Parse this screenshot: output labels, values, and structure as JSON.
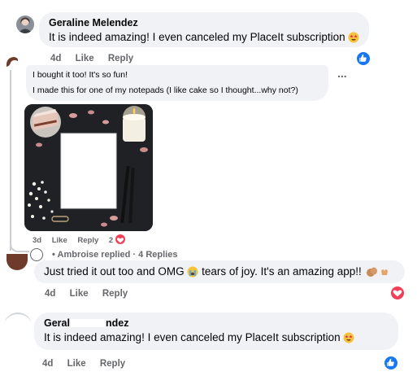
{
  "comment1": {
    "author": "Geraline Melendez",
    "text": "It is indeed amazing! I even canceled my PlaceIt subscription",
    "emoji": "star-struck-emoji",
    "time": "4d",
    "like": "Like",
    "reply": "Reply",
    "reaction": "like-reaction-icon"
  },
  "comment2": {
    "line1": "I bought it too! It's so fun!",
    "line2": "I made this for one of my notepads (I like cake so I thought...why not?)",
    "more": "...",
    "time": "3d",
    "like": "Like",
    "reply": "Reply",
    "reaction_count": "2",
    "reaction": "love-reaction-icon"
  },
  "replies_summary": {
    "author_fragment": "Ambroise replied",
    "separator": "·",
    "count": "4 Replies"
  },
  "comment3": {
    "text": "Just tried it out too and OMG",
    "emoji": "crying-emoji",
    "text2": "tears of joy. It's an amazing app!!",
    "trailing_emojis": "clapping-hands-emoji",
    "time": "4d",
    "like": "Like",
    "reply": "Reply",
    "reaction": "love-reaction-icon"
  },
  "comment4": {
    "author_start": "Geral",
    "author_end": "ndez",
    "text": "It is indeed amazing! I even canceled my PlaceIt subscription",
    "emoji": "star-struck-emoji",
    "time": "4d",
    "like": "Like",
    "reply": "Reply",
    "reaction": "like-reaction-icon"
  },
  "colors": {
    "bubble": "#f0f2f5",
    "meta": "#65676b",
    "like_blue": "#1877f2",
    "love_red": "#f33e58"
  }
}
